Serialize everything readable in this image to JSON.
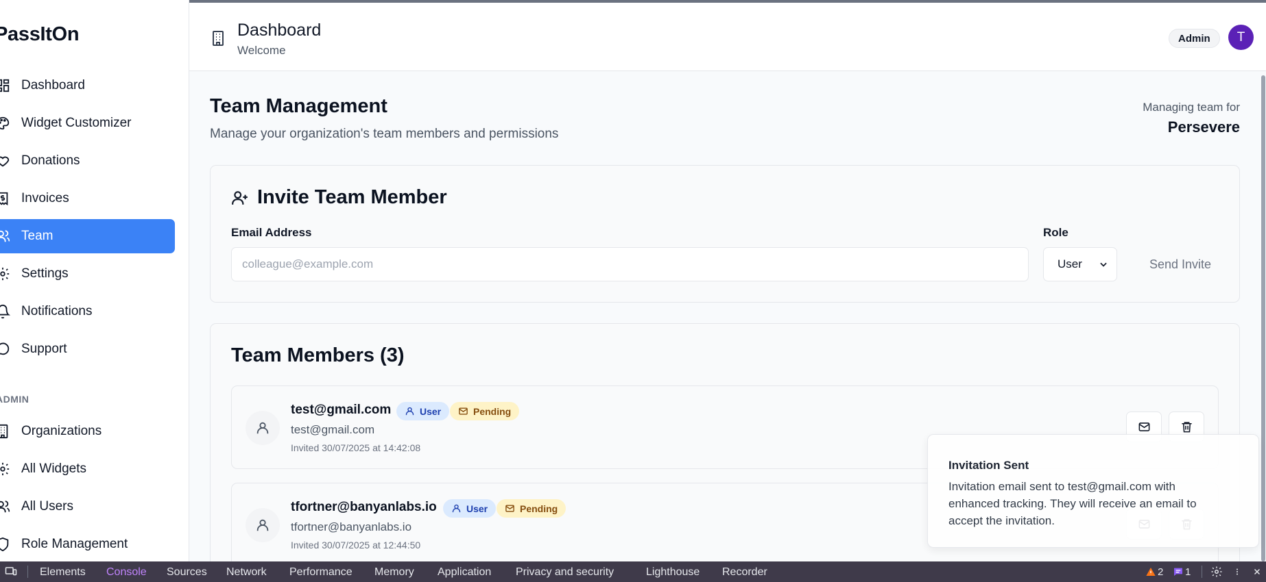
{
  "app": {
    "brand": "PassItOn"
  },
  "sidebar": {
    "items": [
      {
        "label": "Dashboard",
        "icon": "layout-dashboard-icon"
      },
      {
        "label": "Widget Customizer",
        "icon": "palette-icon"
      },
      {
        "label": "Donations",
        "icon": "heart-icon"
      },
      {
        "label": "Invoices",
        "icon": "receipt-icon"
      },
      {
        "label": "Team",
        "icon": "users-icon",
        "active": true
      },
      {
        "label": "Settings",
        "icon": "settings-icon"
      },
      {
        "label": "Notifications",
        "icon": "bell-icon"
      },
      {
        "label": "Support",
        "icon": "message-circle-icon"
      }
    ],
    "admin_label": "ADMIN",
    "admin_items": [
      {
        "label": "Organizations",
        "icon": "building-icon"
      },
      {
        "label": "All Widgets",
        "icon": "settings-icon"
      },
      {
        "label": "All Users",
        "icon": "users-icon"
      },
      {
        "label": "Role Management",
        "icon": "shield-icon"
      }
    ]
  },
  "header": {
    "title": "Dashboard",
    "subtitle": "Welcome",
    "role_badge": "Admin",
    "avatar_initial": "T"
  },
  "main": {
    "title": "Team Management",
    "description": "Manage your organization's team members and permissions",
    "managing_label": "Managing team for",
    "organization": "Persevere"
  },
  "invite": {
    "title": "Invite Team Member",
    "email_label": "Email Address",
    "email_placeholder": "colleague@example.com",
    "email_value": "",
    "role_label": "Role",
    "role_value": "User",
    "send_label": "Send Invite"
  },
  "members": {
    "title": "Team Members (3)",
    "list": [
      {
        "email": "test@gmail.com",
        "sub_email": "test@gmail.com",
        "role": "User",
        "status": "Pending",
        "invited": "Invited 30/07/2025 at 14:42:08"
      },
      {
        "email": "tfortner@banyanlabs.io",
        "sub_email": "tfortner@banyanlabs.io",
        "role": "User",
        "status": "Pending",
        "invited": "Invited 30/07/2025 at 12:44:50"
      }
    ]
  },
  "toast": {
    "title": "Invitation Sent",
    "body": "Invitation email sent to test@gmail.com with enhanced tracking. They will receive an email to accept the invitation."
  },
  "devtools": {
    "tabs": [
      "Elements",
      "Console",
      "Sources",
      "Network",
      "Performance",
      "Memory",
      "Application",
      "Privacy and security",
      "Lighthouse",
      "Recorder"
    ],
    "active_tab": "Console",
    "warnings": "2",
    "messages": "1"
  }
}
